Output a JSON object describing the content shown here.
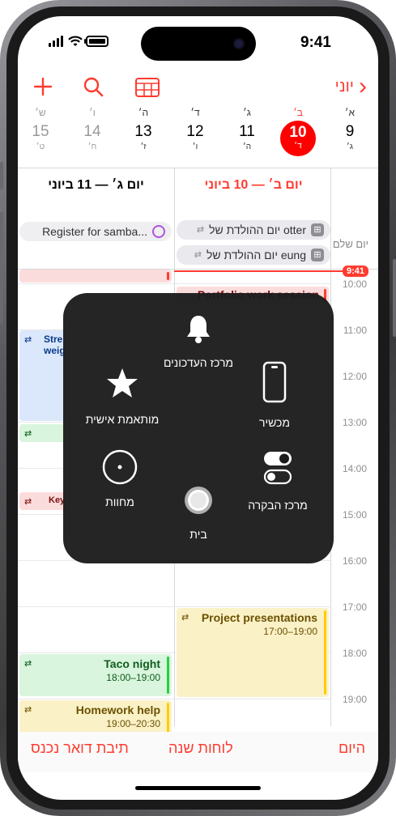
{
  "status": {
    "time": "9:41"
  },
  "toolbar": {
    "back_label": "יוני",
    "add_icon": "plus-icon",
    "search_icon": "search-icon",
    "calendars_icon": "calendar-grid-icon"
  },
  "week": [
    {
      "letter": "א׳",
      "num": "9",
      "sub": "ג׳"
    },
    {
      "letter": "ב׳",
      "num": "10",
      "sub": "ד׳"
    },
    {
      "letter": "ג׳",
      "num": "11",
      "sub": "ה׳"
    },
    {
      "letter": "ד׳",
      "num": "12",
      "sub": "ו׳"
    },
    {
      "letter": "ה׳",
      "num": "13",
      "sub": "ז׳"
    },
    {
      "letter": "ו׳",
      "num": "14",
      "sub": "ח׳"
    },
    {
      "letter": "ש׳",
      "num": "15",
      "sub": "ט׳"
    }
  ],
  "columns": {
    "today_header": "יום ב׳ — 10 ביוני",
    "tomorrow_header": "יום ג׳ — 11 ביוני",
    "allday_label": "יום שלם"
  },
  "allday": {
    "birthday1": "יום ההולדת של otter",
    "birthday2": "יום ההולדת של eung",
    "register": "Register for samba..."
  },
  "now_time": "9:41",
  "hours": [
    "10:00",
    "11:00",
    "12:00",
    "13:00",
    "14:00",
    "15:00",
    "16:00",
    "17:00",
    "18:00",
    "19:00"
  ],
  "events": {
    "portfolio": "Portfolio work session",
    "project_title": "Project presentations",
    "project_time": "17:00–19:00",
    "taco_title": "Taco night",
    "taco_time": "18:00–19:00",
    "homework_title": "Homework help",
    "homework_time": "19:00–20:30",
    "stre_line1": "Stre",
    "stre_line2": "weig",
    "key_partial": "Key"
  },
  "assistive_touch": {
    "notifications": "מרכז העדכונים",
    "device": "מכשיר",
    "custom": "מותאמת אישית",
    "control_center": "מרכז הבקרה",
    "gestures": "מחוות",
    "home": "בית"
  },
  "tabbar": {
    "today": "היום",
    "calendars": "לוחות שנה",
    "inbox": "תיבת דואר נכנס"
  },
  "colors": {
    "accent": "#ff3b30",
    "today_circle": "#ff0000"
  }
}
